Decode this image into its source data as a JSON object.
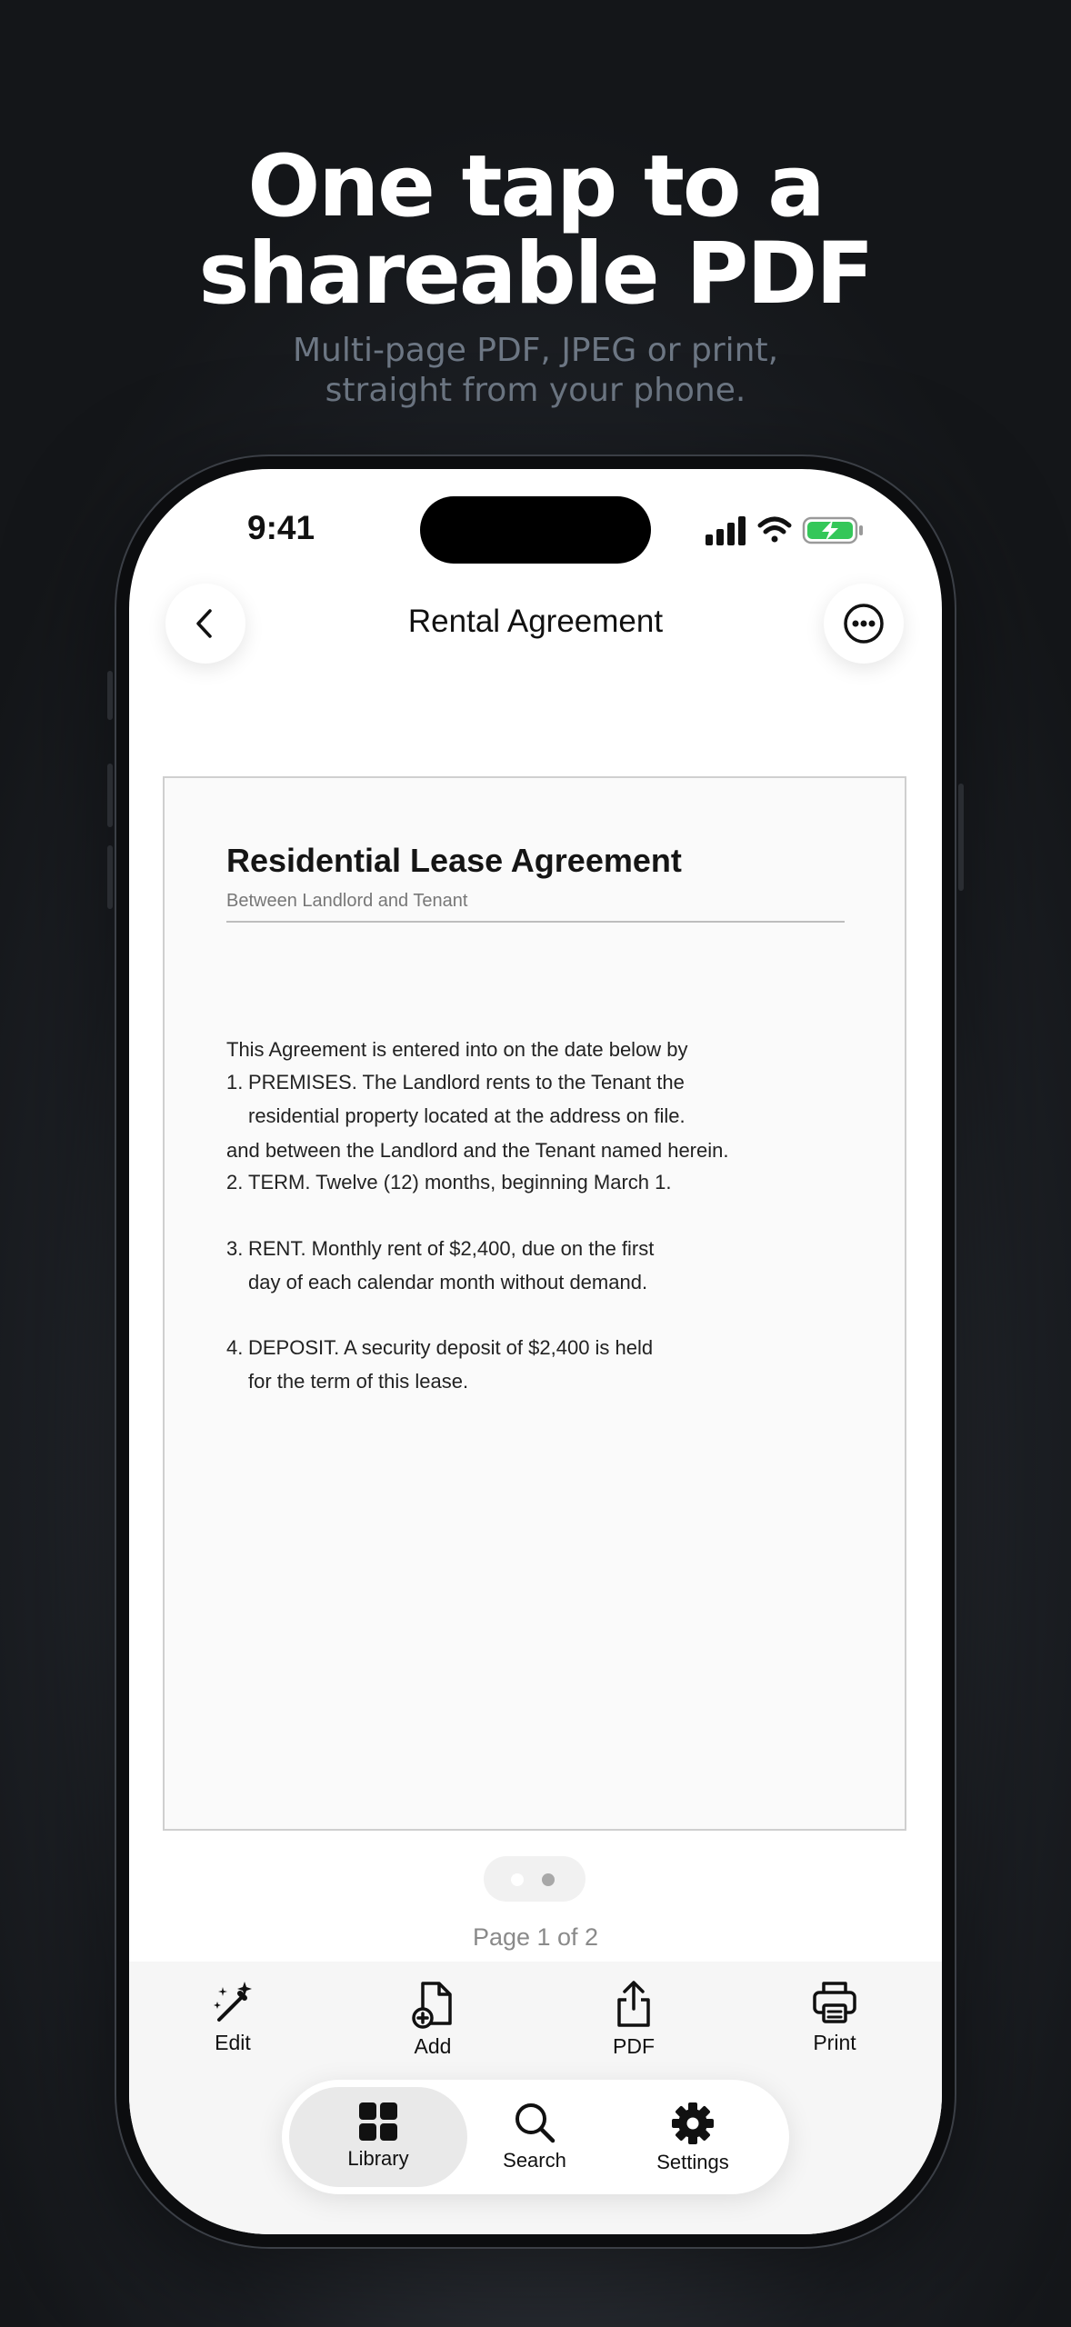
{
  "hero": {
    "headline_line1": "One tap to a",
    "headline_line2": "shareable PDF",
    "subline_line1": "Multi-page PDF, JPEG or print,",
    "subline_line2": "straight from your phone."
  },
  "status_bar": {
    "time": "9:41",
    "icons": [
      "cellular-signal-icon",
      "wifi-icon",
      "battery-charging-icon"
    ],
    "battery_color": "#34c759"
  },
  "nav": {
    "title": "Rental Agreement",
    "back_icon": "chevron-left-icon",
    "more_icon": "ellipsis-circle-icon"
  },
  "document": {
    "title": "Residential Lease Agreement",
    "subtitle": "Between Landlord and Tenant",
    "intro_line1": "This Agreement is entered into on the date below by",
    "intro_line2": "and between the Landlord and the Tenant named herein.",
    "clauses": [
      {
        "number": "1.",
        "line1": "PREMISES.  The Landlord rents to the Tenant the",
        "line2": "residential property located at the address on file."
      },
      {
        "number": "2.",
        "line1": "TERM.  Twelve (12) months, beginning March 1.",
        "line2": ""
      },
      {
        "number": "3.",
        "line1": "RENT.  Monthly rent of $2,400, due on the first",
        "line2": "day of each calendar month without demand."
      },
      {
        "number": "4.",
        "line1": "DEPOSIT.  A security deposit of $2,400 is held",
        "line2": "for the term of this lease."
      }
    ]
  },
  "pager": {
    "label": "Page 1 of 2",
    "current_page": 1,
    "total_pages": 2
  },
  "toolbar": {
    "edit_label": "Edit",
    "add_label": "Add",
    "pdf_label": "PDF",
    "print_label": "Print",
    "icons": [
      "magic-wand-icon",
      "add-document-icon",
      "share-icon",
      "printer-icon"
    ]
  },
  "tabbar": {
    "library_label": "Library",
    "search_label": "Search",
    "settings_label": "Settings",
    "active_tab": "Library",
    "icons": [
      "grid-icon",
      "magnifier-icon",
      "gear-icon"
    ]
  }
}
